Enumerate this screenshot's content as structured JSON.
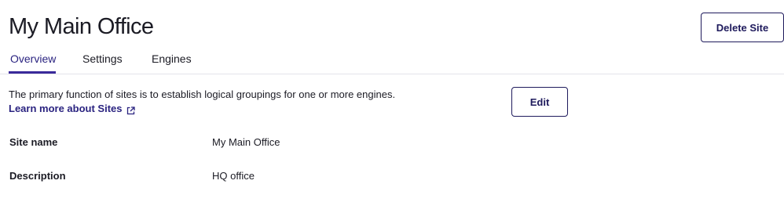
{
  "header": {
    "title": "My Main Office",
    "delete_label": "Delete Site"
  },
  "tabs": [
    {
      "label": "Overview",
      "active": true
    },
    {
      "label": "Settings",
      "active": false
    },
    {
      "label": "Engines",
      "active": false
    }
  ],
  "overview": {
    "intro": "The primary function of sites is to establish logical groupings for one or more engines.",
    "learn_more_label": "Learn more about Sites",
    "learn_more_icon": "external-link-icon",
    "edit_label": "Edit",
    "fields": [
      {
        "label": "Site name",
        "value": "My Main Office"
      },
      {
        "label": "Description",
        "value": "HQ office"
      }
    ]
  },
  "colors": {
    "accent": "#2a2380",
    "button_border": "#1e1a5c",
    "divider": "#e4e4ea",
    "text": "#1b1b24"
  }
}
